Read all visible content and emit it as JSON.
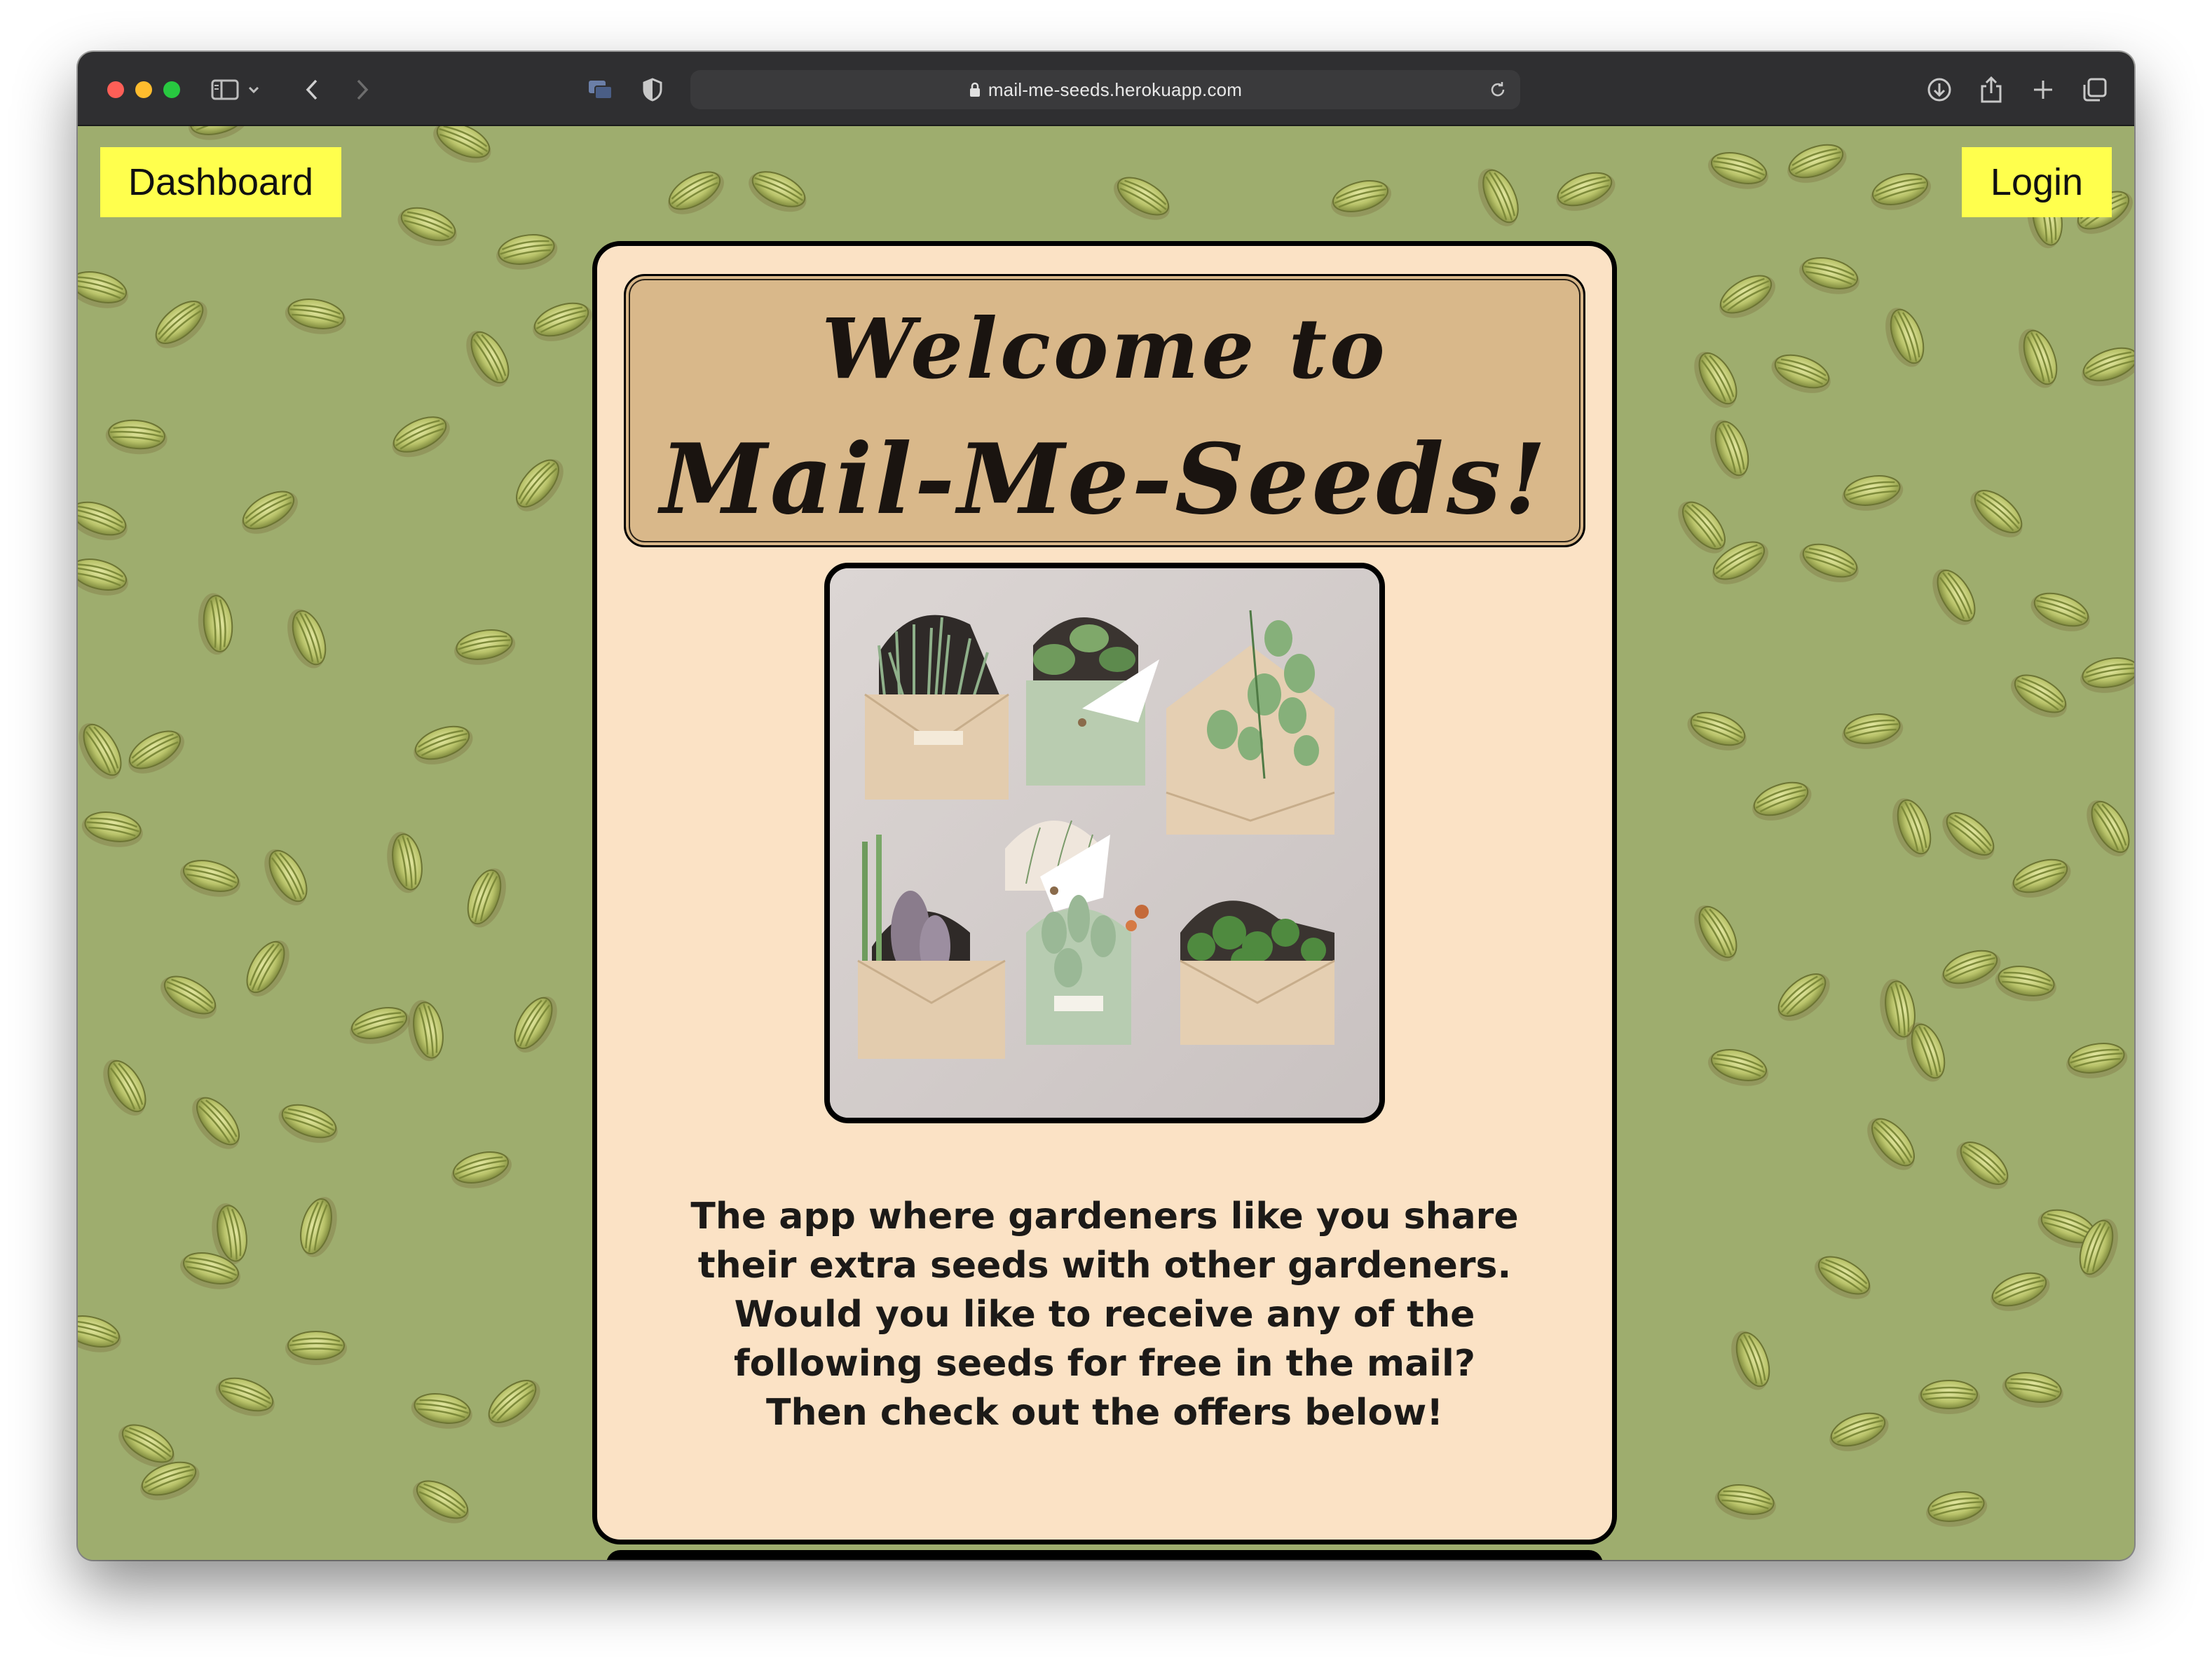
{
  "browser": {
    "url": "mail-me-seeds.herokuapp.com",
    "icons": [
      "sidebar-icon",
      "chevron-down-icon",
      "back-icon",
      "forward-icon",
      "tab-icon",
      "privacy-shield-icon",
      "lock-icon",
      "reload-icon",
      "download-icon",
      "share-icon",
      "new-tab-icon",
      "tab-overview-icon"
    ]
  },
  "nav": {
    "dashboard_label": "Dashboard",
    "login_label": "Login",
    "button_color": "#ffff4d"
  },
  "hero": {
    "title_line_1": "Welcome to",
    "title_line_2": "Mail-Me-Seeds!",
    "tagline": "The app where gardeners like you share their extra seeds with other gardeners. Would you like to receive any of the following seeds for free in the mail? Then check out the offers below!"
  },
  "colors": {
    "background": "#9ead6e",
    "card": "#fbe2c5",
    "title_box": "#d9b88a"
  }
}
